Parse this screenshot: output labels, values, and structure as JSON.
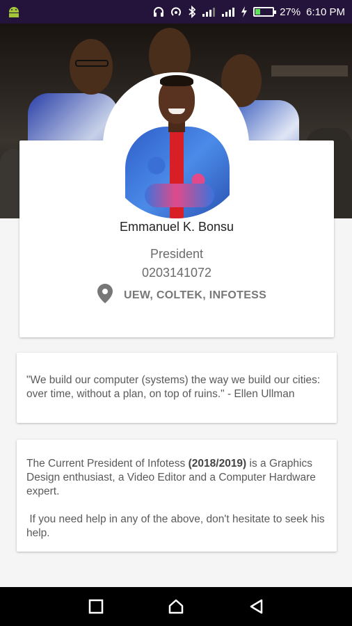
{
  "status_bar": {
    "battery_percent": "27%",
    "time": "6:10 PM",
    "battery_level": 0.27,
    "icons": [
      "android-icon",
      "headphones-icon",
      "hotspot-icon",
      "bluetooth-icon",
      "signal-icon",
      "signal-icon-2",
      "charging-icon",
      "battery-icon"
    ]
  },
  "profile": {
    "name": "Emmanuel K. Bonsu",
    "role": "President",
    "phone": "0203141072",
    "location": "UEW, COLTEK, INFOTESS"
  },
  "quote": {
    "text": "\"We build our computer (systems) the way we build our cities: over time, without a plan, on top of ruins.\" - Ellen Ullman"
  },
  "bio": {
    "p1_before": "The Current President of Infotess ",
    "p1_bold": "(2018/2019)",
    "p1_after": " is a Graphics Design enthusiast, a Video Editor and a Computer Hardware expert.",
    "p2": " If you need help in any of the above, don't hesitate to seek his help."
  },
  "nav": {
    "icons": [
      "recent-apps-icon",
      "home-icon",
      "back-icon"
    ]
  },
  "colors": {
    "status_bar": "#24133a",
    "accent_battery": "#5fe35a",
    "card_bg": "#ffffff",
    "page_bg": "#f5f5f5"
  }
}
